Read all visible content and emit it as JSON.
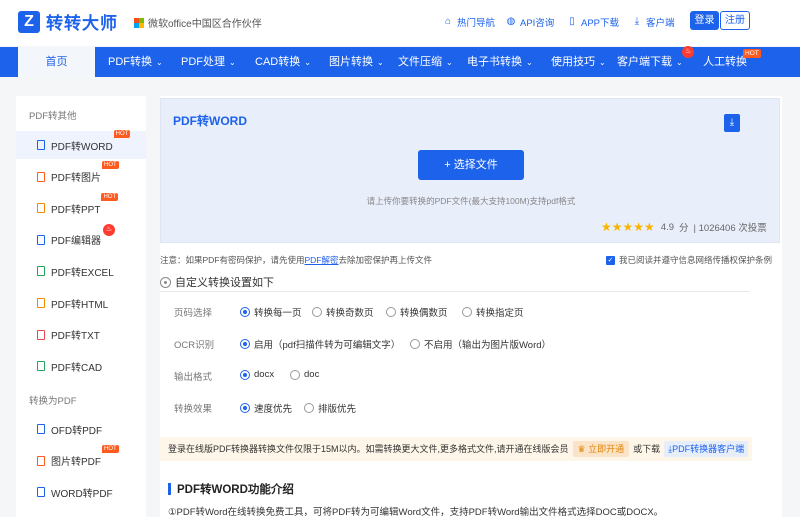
{
  "brand": {
    "name": "转转大师",
    "mark": "Z",
    "partner": "微软office中国区合作伙伴"
  },
  "top_links": [
    {
      "label": "热门导航",
      "icon": "home-icon"
    },
    {
      "label": "API咨询",
      "icon": "globe-icon"
    },
    {
      "label": "APP下载",
      "icon": "phone-icon"
    },
    {
      "label": "客户端",
      "icon": "download-icon"
    }
  ],
  "auth": {
    "login": "登录",
    "register": "注册"
  },
  "nav": {
    "home": "首页",
    "items": [
      "PDF转换",
      "PDF处理",
      "CAD转换",
      "图片转换",
      "文件压缩",
      "电子书转换",
      "使用技巧",
      "客户端下载",
      "人工转换"
    ],
    "hot_label": "HOT"
  },
  "sidebar": {
    "group1": "PDF转其他",
    "group1_items": [
      {
        "label": "PDF转WORD",
        "color": "#1d62ea",
        "badge": "HOT"
      },
      {
        "label": "PDF转图片",
        "color": "#ff5a1f",
        "badge": "HOT"
      },
      {
        "label": "PDF转PPT",
        "color": "#f08a00",
        "badge": "HOT"
      },
      {
        "label": "PDF编辑器",
        "color": "#1d62ea",
        "badge": "fire"
      },
      {
        "label": "PDF转EXCEL",
        "color": "#22a55a",
        "badge": ""
      },
      {
        "label": "PDF转HTML",
        "color": "#f08a00",
        "badge": ""
      },
      {
        "label": "PDF转TXT",
        "color": "#e5484d",
        "badge": ""
      },
      {
        "label": "PDF转CAD",
        "color": "#22a55a",
        "badge": ""
      }
    ],
    "group2": "转换为PDF",
    "group2_items": [
      {
        "label": "OFD转PDF",
        "color": "#1d62ea",
        "badge": ""
      },
      {
        "label": "图片转PDF",
        "color": "#ff5a1f",
        "badge": "HOT"
      },
      {
        "label": "WORD转PDF",
        "color": "#1d62ea",
        "badge": ""
      }
    ]
  },
  "upload": {
    "title": "PDF转WORD",
    "button": "+ 选择文件",
    "hint": "请上传你要转换的PDF文件(最大支持100M)支持pdf格式",
    "stars": "★★★★★",
    "score": "4.9",
    "score_unit": "分",
    "votes": "| 1026406 次投票"
  },
  "notice": {
    "prefix": "注意：如果PDF有密码保护，请先使用",
    "link": "PDF解密",
    "suffix": "去除加密保护再上传文件"
  },
  "agree": "我已阅读并遵守信息网络传播权保护条例",
  "settings": {
    "title": "自定义转换设置如下",
    "rows": [
      {
        "label": "页码选择",
        "options": [
          "转换每一页",
          "转换奇数页",
          "转换偶数页",
          "转换指定页"
        ],
        "selected": 0
      },
      {
        "label": "OCR识别",
        "options": [
          "启用（pdf扫描件转为可编辑文字）",
          "不启用（输出为图片版Word）"
        ],
        "selected": 0
      },
      {
        "label": "输出格式",
        "options": [
          "docx",
          "doc"
        ],
        "selected": 0
      },
      {
        "label": "转换效果",
        "options": [
          "速度优先",
          "排版优先"
        ],
        "selected": 0
      }
    ]
  },
  "info": {
    "text": "登录在线版PDF转换器转换文件仅限于15M以内。如需转换更大文件,更多格式文件,请开通在线版会员",
    "open": "立即开通",
    "or": "或下载",
    "client": "PDF转换器客户端"
  },
  "intro": {
    "title": "PDF转WORD功能介绍",
    "text": "①PDF转Word在线转换免费工具，可将PDF转为可编辑Word文件，支持PDF转Word输出文件格式选择DOC或DOCX。"
  },
  "colors": {
    "primary": "#1d62ea",
    "hot": "#ff5a1f",
    "star": "#f8b500"
  }
}
